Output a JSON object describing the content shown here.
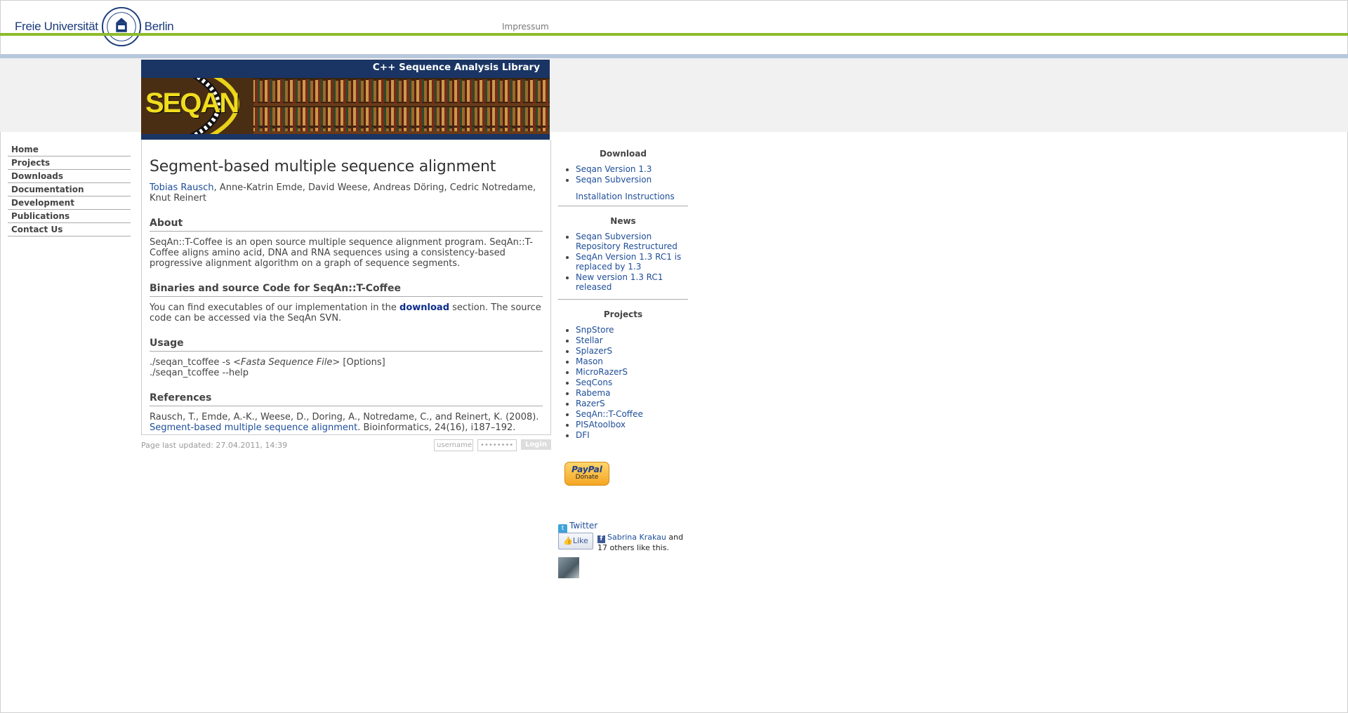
{
  "header": {
    "uni_left": "Freie Universität",
    "uni_right": "Berlin",
    "impressum": "Impressum"
  },
  "banner": {
    "title": "C++ Sequence Analysis Library",
    "logo_text": "SEQAN"
  },
  "nav": {
    "items": [
      {
        "label": "Home"
      },
      {
        "label": "Projects"
      },
      {
        "label": "Downloads"
      },
      {
        "label": "Documentation"
      },
      {
        "label": "Development"
      },
      {
        "label": "Publications"
      },
      {
        "label": "Contact Us"
      }
    ]
  },
  "content": {
    "title": "Segment-based multiple sequence alignment",
    "author_link": "Tobias Rausch",
    "authors_rest": ", Anne-Katrin Emde, David Weese, Andreas Döring, Cedric Notredame, Knut Reinert",
    "about_heading": "About",
    "about_text": "SeqAn::T-Coffee is an open source multiple sequence alignment program. SeqAn::T-Coffee aligns amino acid, DNA and RNA sequences using a consistency-based progressive alignment algorithm on a graph of sequence segments.",
    "binaries_heading": "Binaries and source Code for SeqAn::T-Coffee",
    "binaries_pre": "You can find executables of our implementation in the ",
    "binaries_link": "download",
    "binaries_post": " section. The source code can be accessed via the SeqAn SVN.",
    "usage_heading": "Usage",
    "usage_line1_pre": "./seqan_tcoffee -s <",
    "usage_line1_em": "Fasta Sequence File",
    "usage_line1_post": "> [Options]",
    "usage_line2": "./seqan_tcoffee --help",
    "references_heading": "References",
    "ref_pre": "Rausch, T., Emde, A.-K., Weese, D., Doring, A., Notredame, C., and Reinert, K. (2008). ",
    "ref_link": "Segment-based multiple sequence alignment",
    "ref_post": ". Bioinformatics, 24(16), i187–192."
  },
  "footer": {
    "updated": "Page last updated: 27.04.2011, 14:39",
    "username_placeholder": "username",
    "password_placeholder": "••••••••",
    "login_label": "Login"
  },
  "sidebar": {
    "download_heading": "Download",
    "download_items": [
      "Seqan Version 1.3",
      "Seqan Subversion"
    ],
    "install_link": "Installation Instructions",
    "news_heading": "News",
    "news_items": [
      "Seqan Subversion Repository Restructured",
      "SeqAn Version 1.3 RC1 is replaced by 1.3",
      "New version 1.3 RC1 released"
    ],
    "projects_heading": "Projects",
    "project_items": [
      "SnpStore",
      "Stellar",
      "SplazerS",
      "Mason",
      "MicroRazerS",
      "SeqCons",
      "Rabema",
      "RazerS",
      "SeqAn::T-Coffee",
      "PISAtoolbox",
      "DFI"
    ],
    "paypal_logo": "PayPal",
    "paypal_label": "Donate",
    "twitter": "Twitter",
    "like_label": "Like",
    "fb_name": "Sabrina Krakau",
    "fb_rest": " and 17 others like this."
  }
}
